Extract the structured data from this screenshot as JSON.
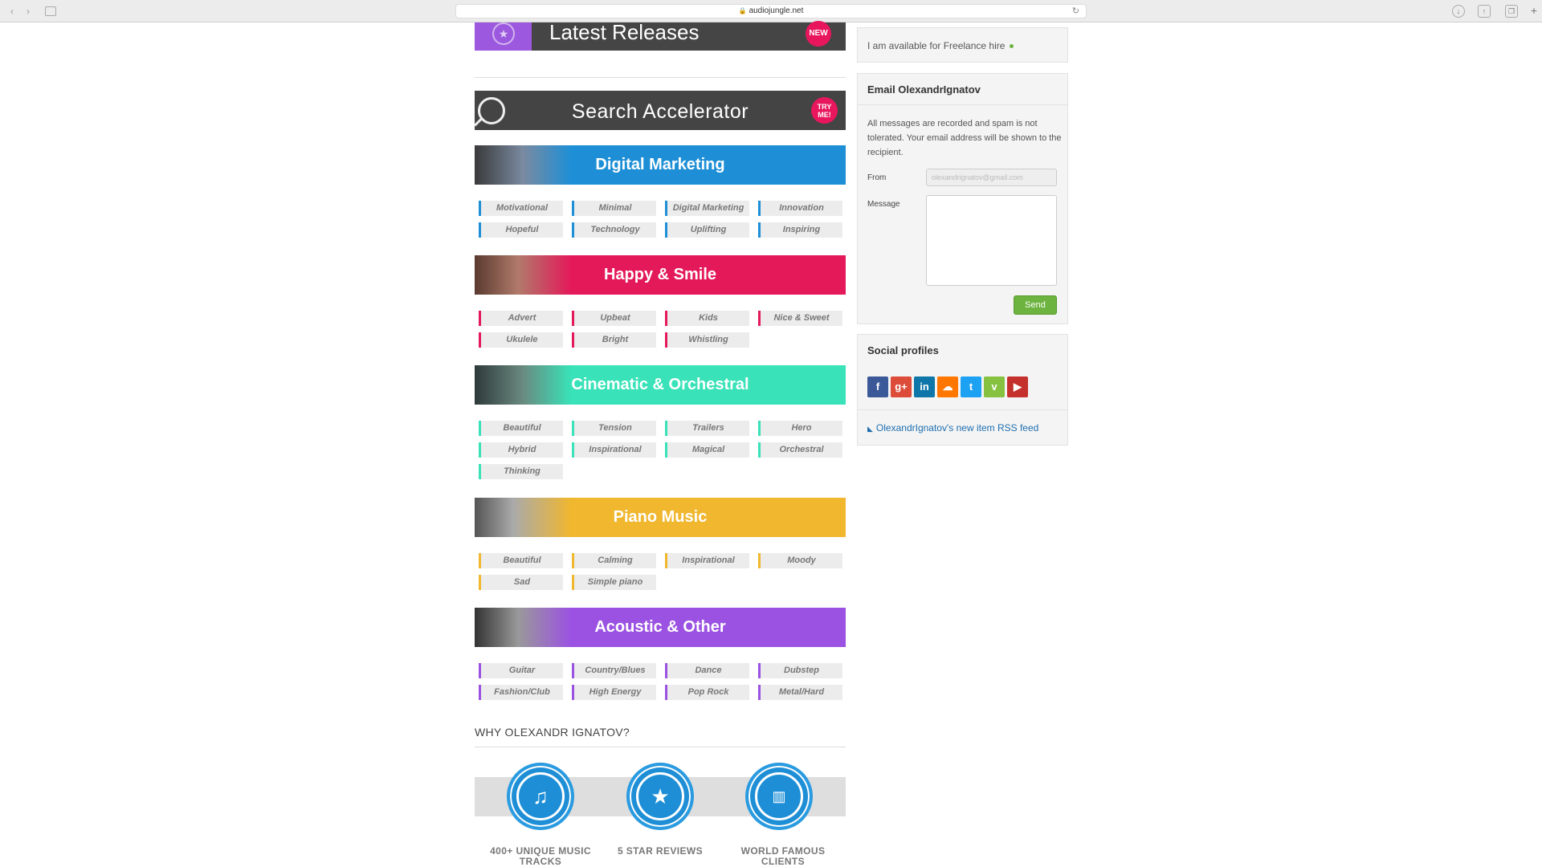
{
  "browser": {
    "url": "audiojungle.net"
  },
  "latest": {
    "title": "Latest Releases",
    "badge": "NEW"
  },
  "search_accelerator": {
    "title": "Search Accelerator",
    "badge": "TRY ME!"
  },
  "categories": [
    {
      "title": "Digital Marketing",
      "color": "#1e8fd6",
      "tags": [
        "Motivational",
        "Minimal",
        "Digital Marketing",
        "Innovation",
        "Hopeful",
        "Technology",
        "Uplifting",
        "Inspiring"
      ]
    },
    {
      "title": "Happy & Smile",
      "color": "#e4195a",
      "tags": [
        "Advert",
        "Upbeat",
        "Kids",
        "Nice & Sweet",
        "Ukulele",
        "Bright",
        "Whistling"
      ]
    },
    {
      "title": "Cinematic & Orchestral",
      "color": "#39e2b8",
      "tags": [
        "Beautiful",
        "Tension",
        "Trailers",
        "Hero",
        "Hybrid",
        "Inspirational",
        "Magical",
        "Orchestral",
        "Thinking"
      ]
    },
    {
      "title": "Piano Music",
      "color": "#f0b72f",
      "tags": [
        "Beautiful",
        "Calming",
        "Inspirational",
        "Moody",
        "Sad",
        "Simple piano"
      ]
    },
    {
      "title": "Acoustic & Other",
      "color": "#9b52e2",
      "tags": [
        "Guitar",
        "Country/Blues",
        "Dance",
        "Dubstep",
        "Fashion/Club",
        "High Energy",
        "Pop Rock",
        "Metal/Hard"
      ]
    }
  ],
  "why": {
    "title": "WHY OLEXANDR IGNATOV?",
    "items": [
      {
        "icon": "music-note-icon",
        "label": "400+ UNIQUE MUSIC TRACKS"
      },
      {
        "icon": "star-icon",
        "label": "5 STAR REVIEWS"
      },
      {
        "icon": "clients-icon",
        "label": "WORLD FAMOUS CLIENTS"
      }
    ]
  },
  "sidebar": {
    "freelance": "I am available for Freelance hire",
    "email": {
      "heading": "Email OlexandrIgnatov",
      "description": "All messages are recorded and spam is not tolerated. Your email address will be shown to the recipient.",
      "from_label": "From",
      "from_value": "olexandrignatov@gmail.com",
      "message_label": "Message",
      "send_label": "Send"
    },
    "social": {
      "heading": "Social profiles",
      "icons": [
        {
          "name": "facebook-icon",
          "glyph": "f",
          "color": "#3b5998"
        },
        {
          "name": "google-plus-icon",
          "glyph": "g+",
          "color": "#dd4b39"
        },
        {
          "name": "linkedin-icon",
          "glyph": "in",
          "color": "#0e76a8"
        },
        {
          "name": "soundcloud-icon",
          "glyph": "☁",
          "color": "#ff7700"
        },
        {
          "name": "twitter-icon",
          "glyph": "t",
          "color": "#1da1f2"
        },
        {
          "name": "vimeo-icon",
          "glyph": "v",
          "color": "#86c140"
        },
        {
          "name": "youtube-icon",
          "glyph": "▶",
          "color": "#c4302b"
        }
      ],
      "rss": "OlexandrIgnatov's new item RSS feed"
    }
  }
}
